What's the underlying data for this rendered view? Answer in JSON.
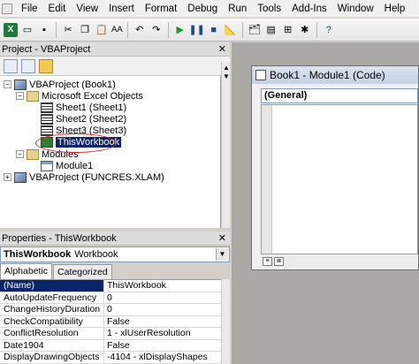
{
  "menubar": {
    "items": [
      "File",
      "Edit",
      "View",
      "Insert",
      "Format",
      "Debug",
      "Run",
      "Tools",
      "Add-Ins",
      "Window",
      "Help"
    ]
  },
  "toolbar": {
    "icons": [
      "excel-icon",
      "insert-userform-icon",
      "save-icon",
      "cut-icon",
      "copy-icon",
      "paste-icon",
      "find-icon",
      "undo-icon",
      "redo-icon",
      "run-icon",
      "break-icon",
      "reset-icon",
      "design-mode-icon",
      "project-explorer-icon",
      "properties-icon",
      "object-browser-icon",
      "toolbox-icon",
      "help-icon"
    ],
    "find_label": "AA"
  },
  "project": {
    "title": "Project - VBAProject",
    "tree": [
      {
        "label": "VBAProject (Book1)",
        "expander": "−"
      },
      {
        "label": "Microsoft Excel Objects",
        "expander": "−"
      },
      {
        "label": "Sheet1 (Sheet1)"
      },
      {
        "label": "Sheet2 (Sheet2)"
      },
      {
        "label": "Sheet3 (Sheet3)"
      },
      {
        "label": "ThisWorkbook",
        "selected": true
      },
      {
        "label": "Modules",
        "expander": "−"
      },
      {
        "label": "Module1"
      },
      {
        "label": "VBAProject (FUNCRES.XLAM)",
        "expander": "+"
      }
    ]
  },
  "properties": {
    "title": "Properties - ThisWorkbook",
    "object_name": "ThisWorkbook",
    "object_type": "Workbook",
    "tabs": [
      "Alphabetic",
      "Categorized"
    ],
    "active_tab": "Alphabetic",
    "rows": [
      {
        "name": "(Name)",
        "value": "ThisWorkbook"
      },
      {
        "name": "AutoUpdateFrequency",
        "value": "0"
      },
      {
        "name": "ChangeHistoryDuration",
        "value": "0"
      },
      {
        "name": "CheckCompatibility",
        "value": "False"
      },
      {
        "name": "ConflictResolution",
        "value": "1 - xlUserResolution"
      },
      {
        "name": "Date1904",
        "value": "False"
      },
      {
        "name": "DisplayDrawingObjects",
        "value": "-4104 - xlDisplayShapes"
      }
    ]
  },
  "code_window": {
    "title": "Book1 - Module1 (Code)",
    "object_combo": "(General)"
  },
  "colors": {
    "selection": "#0a246a",
    "annotation_circle": "#e02020",
    "mdi_background": "#aba9a6"
  }
}
